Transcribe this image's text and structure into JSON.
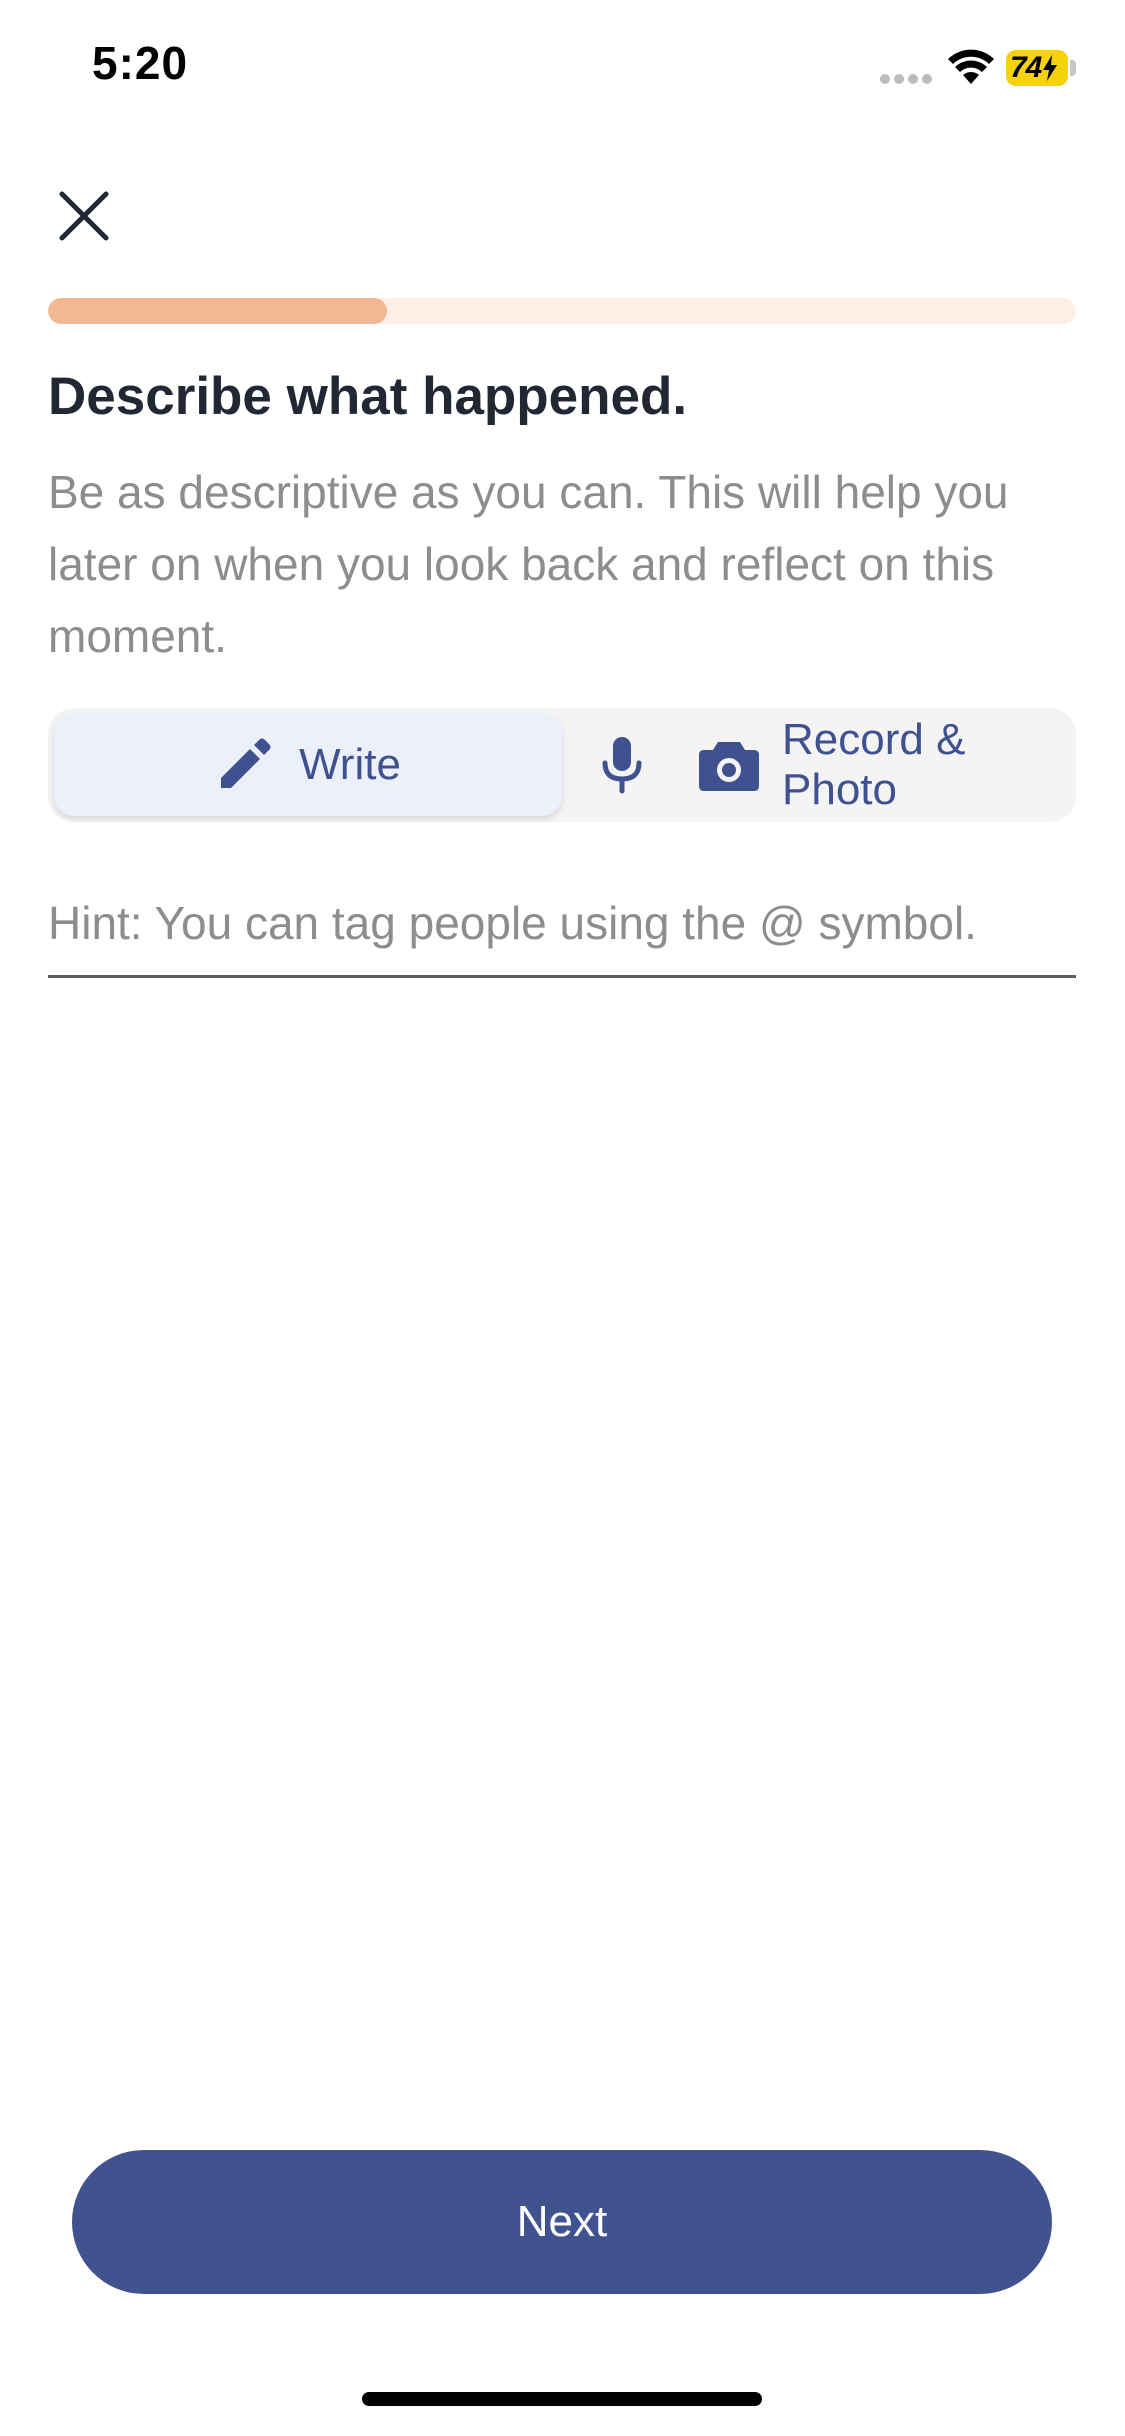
{
  "status_bar": {
    "time": "5:20",
    "battery": "74"
  },
  "progress": {
    "fraction": 0.33,
    "fill_color": "#f2b893",
    "track_color": "#fdeee6"
  },
  "header": {
    "close_icon": "close-icon"
  },
  "main": {
    "title": "Describe what happened.",
    "subtitle": "Be as descriptive as you can. This will help you later on when you look back and reflect on this moment."
  },
  "modes": {
    "write_label": "Write",
    "write_icon": "pencil-icon",
    "record_label": "Record & Photo",
    "record_icons": [
      "microphone-icon",
      "camera-icon"
    ],
    "accent_color": "#3f528f"
  },
  "entry": {
    "placeholder": "Hint: You can tag people using the @ symbol.",
    "value": ""
  },
  "footer": {
    "next_label": "Next",
    "button_color": "#40538e"
  }
}
